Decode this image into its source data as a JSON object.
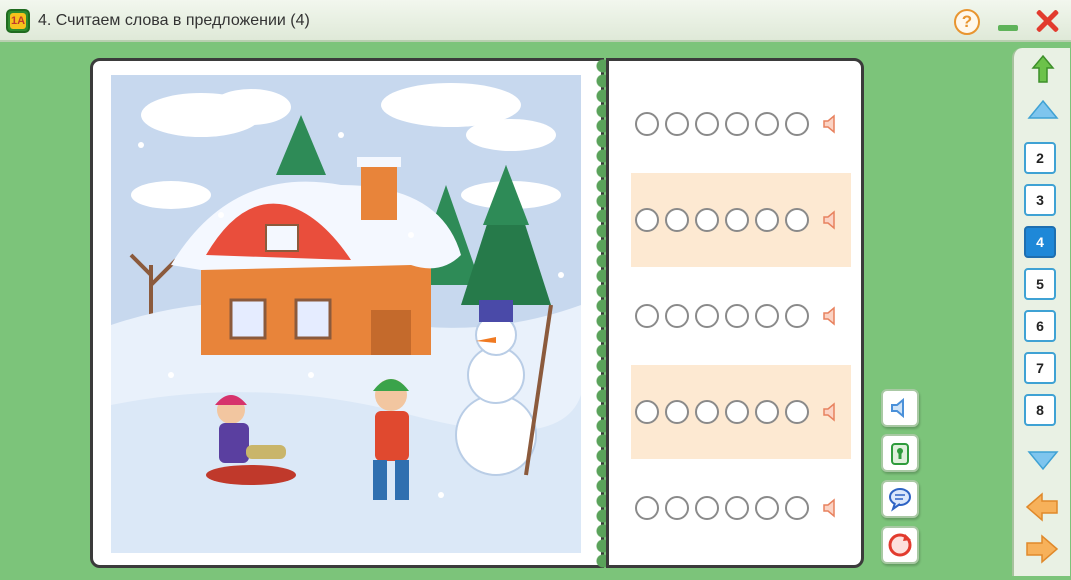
{
  "window": {
    "app_icon_label": "1А",
    "title": "4. Считаем слова в предложении (4)",
    "help_label": "?",
    "colors": {
      "title_bar": "#e8f0e2",
      "background": "#7cc47a",
      "accent_close": "#e23b2e",
      "accent_help": "#e89530"
    }
  },
  "illustration": {
    "description_icon": "winter-scene-illustration"
  },
  "exercise": {
    "rows": [
      {
        "circles": 6,
        "speaker_icon": "speaker-icon",
        "shaded": false
      },
      {
        "circles": 6,
        "speaker_icon": "speaker-icon",
        "shaded": true
      },
      {
        "circles": 6,
        "speaker_icon": "speaker-icon",
        "shaded": false
      },
      {
        "circles": 6,
        "speaker_icon": "speaker-icon",
        "shaded": true
      },
      {
        "circles": 6,
        "speaker_icon": "speaker-icon",
        "shaded": false
      }
    ]
  },
  "tools": [
    {
      "icon": "speaker-icon",
      "color": "#4a90d9"
    },
    {
      "icon": "keyhole-icon",
      "color": "#2e9b3c"
    },
    {
      "icon": "speech-bubble-icon",
      "color": "#2e63c4"
    },
    {
      "icon": "refresh-icon",
      "color": "#e23b2e"
    }
  ],
  "nav": {
    "pages": [
      "2",
      "3",
      "4",
      "5",
      "6",
      "7",
      "8"
    ],
    "active_page": "4",
    "up_icon": "return-up-icon",
    "scroll_up_icon": "triangle-up-icon",
    "scroll_down_icon": "triangle-down-icon",
    "prev_icon": "arrow-left-icon",
    "next_icon": "arrow-right-icon"
  }
}
